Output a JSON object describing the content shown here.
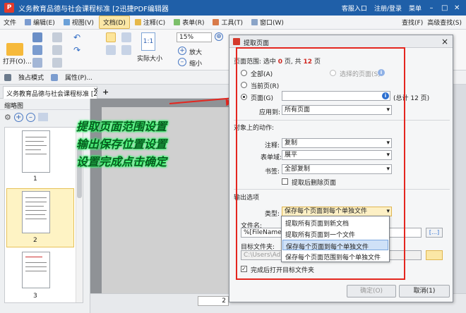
{
  "window": {
    "title": "义务教育品德与社会课程标准 [2迅捷PDF编辑器",
    "login_label": "客服入口",
    "register_label": "注册/登录",
    "menu_label": "菜单"
  },
  "menubar": {
    "items": [
      {
        "label": "文件"
      },
      {
        "label": "编辑(E)"
      },
      {
        "label": "视图(V)"
      },
      {
        "label": "文档(D)"
      },
      {
        "label": "注释(C)"
      },
      {
        "label": "表单(R)"
      },
      {
        "label": "工具(T)"
      },
      {
        "label": "窗口(W)"
      }
    ],
    "right": {
      "find": "查找(F)",
      "advanced_find": "高级查找(S)"
    }
  },
  "toolbar": {
    "open_label": "打开(O)...",
    "zoom_value": "15%",
    "actual_size_label": "实际大小",
    "zoom_in_label": "放大",
    "zoom_out_label": "缩小"
  },
  "toolbar2": {
    "exclusive_mode": "独占模式",
    "properties": "属性(P)..."
  },
  "tab": {
    "label": "义务教育品德与社会课程标准 [2",
    "close": "×",
    "add": "+"
  },
  "thumbnails": {
    "title": "缩略图",
    "pages": [
      {
        "num": "1"
      },
      {
        "num": "2"
      },
      {
        "num": "3"
      }
    ]
  },
  "status": {
    "page_value": "2"
  },
  "annotations": [
    "提取页面范围设置",
    "输出保存位置设置",
    "设置完成点击确定"
  ],
  "dialog": {
    "title": "提取页面",
    "close": "×",
    "page_range": {
      "header_prefix": "页面范围: 选中",
      "selected_count": "0",
      "header_mid": "页, 共",
      "total_count": "12",
      "header_suffix": "页",
      "all_label": "全部(A)",
      "selected_pages_label": "选择的页面(S)",
      "current_label": "当前页(R)",
      "pages_label": "页面(G)",
      "pages_total": "(总计 12 页)",
      "apply_label": "应用到:",
      "apply_value": "所有页面"
    },
    "object_actions": {
      "header": "对象上的动作:",
      "annotation_label": "注释:",
      "annotation_value": "复制",
      "form_label": "表单域:",
      "form_value": "展平",
      "bookmark_label": "书签:",
      "bookmark_value": "全部复制",
      "delete_after_label": "提取后删除页面"
    },
    "output": {
      "header": "输出选项",
      "type_label": "类型:",
      "type_value": "保存每个页面到每个单独文件",
      "filename_label": "文件名:",
      "filename_value": "%[FileName]_%",
      "folder_label": "目标文件夹:",
      "folder_value": "C:\\Users\\Adm",
      "open_folder_label": "完成后打开目标文件夹",
      "options": [
        "提取所有页面到新文档",
        "提取所有页面到一个文件",
        "保存每个页面到每个单独文件",
        "保存每个页面范围到每个单独文件"
      ],
      "macro_btn": "[…]"
    },
    "ok_label": "确定(O)",
    "cancel_label": "取消(1)"
  },
  "colors": {
    "title_bar": "#1f5fa8",
    "accent_red": "#e4261f",
    "annotation_green": "#32ff6a"
  }
}
